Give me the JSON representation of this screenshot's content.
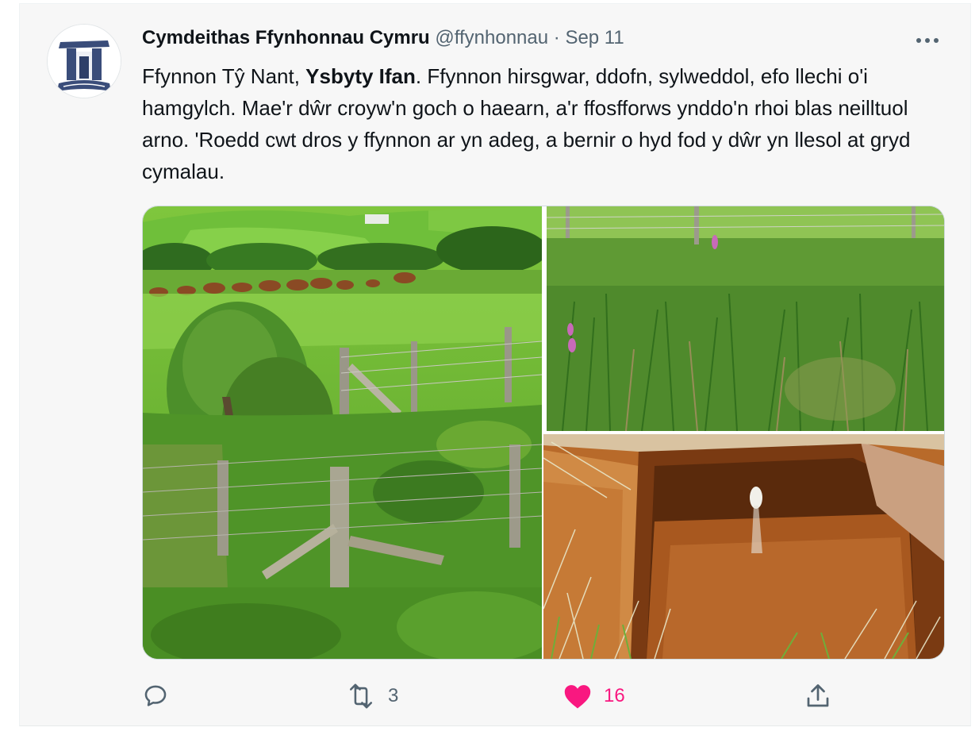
{
  "tweet": {
    "author_name": "Cymdeithas Ffynhonnau Cymru",
    "author_handle": "@ffynhonnau",
    "separator": "·",
    "date": "Sep 11",
    "text_part1": "Ffynnon Tŷ Nant, ",
    "text_bold": "Ysbyty Ifan",
    "text_part2": ". Ffynnon hirsgwar, ddofn, sylweddol, efo llechi o'i hamgylch. Mae'r dŵr croyw'n goch o haearn, a'r ffosfforws ynddo'n rhoi blas neilltuol arno. 'Roedd cwt dros y ffynnon ar yn adeg, a bernir o hyd fod y dŵr yn llesol at gryd cymalau."
  },
  "actions": {
    "reply_icon": "reply-icon",
    "retweet_icon": "retweet-icon",
    "retweet_count": "3",
    "like_icon": "heart-icon-filled",
    "like_count": "16",
    "share_icon": "share-icon"
  },
  "colors": {
    "accent_like": "#f91880",
    "muted": "#536471",
    "text": "#0f1419"
  }
}
